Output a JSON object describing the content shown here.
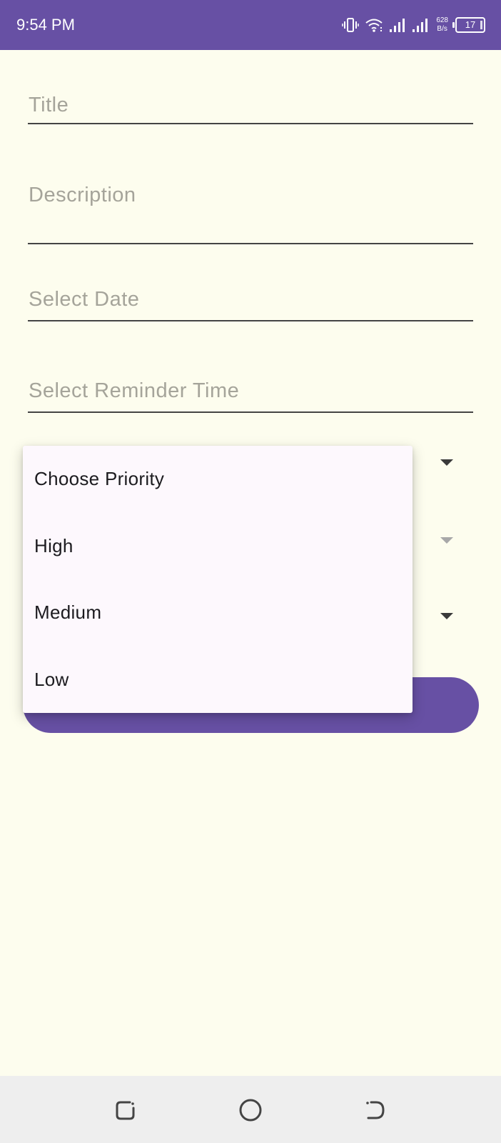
{
  "status_bar": {
    "time": "9:54 PM",
    "net_speed_value": "628",
    "net_speed_unit": "B/s",
    "battery_level": "17",
    "icons": [
      "vibrate-icon",
      "wifi-icon",
      "signal-icon",
      "signal-icon-2",
      "battery-icon"
    ],
    "background_color": "#6750a4"
  },
  "form": {
    "title_placeholder": "Title",
    "description_placeholder": "Description",
    "date_placeholder": "Select Date",
    "reminder_time_placeholder": "Select Reminder Time"
  },
  "priority_dropdown": {
    "options": [
      "Choose Priority",
      "High",
      "Medium",
      "Low"
    ]
  },
  "save_button": {
    "label": "",
    "color": "#6750a4"
  },
  "nav_bar": {
    "icons": [
      "recent-apps-icon",
      "home-icon",
      "back-icon"
    ]
  },
  "colors": {
    "background": "#fdfdee",
    "accent": "#6750a4",
    "placeholder_text": "#a5a49a"
  }
}
